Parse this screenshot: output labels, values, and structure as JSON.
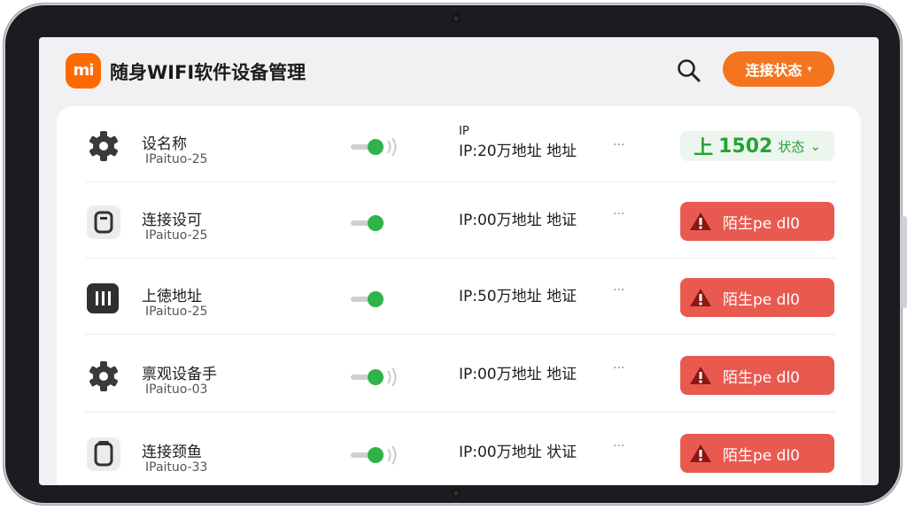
{
  "header": {
    "logo_text": "mi",
    "title": "随身WIFI软件设备管理",
    "status_button_label": "连接状态",
    "status_button_caret": "▾"
  },
  "colors": {
    "accent": "#f4741f",
    "logo": "#ff6a00",
    "online_green": "#24a234",
    "warning_red": "#e85a50"
  },
  "devices": [
    {
      "icon": "gear-icon",
      "name": "设名称",
      "sub": "IPaituo-25",
      "ip_label": "IP",
      "ip": "IP:20万地址 地址",
      "more": "···",
      "toggle_on": true,
      "status_type": "ok",
      "status_prefix": "上",
      "status_value": "1502",
      "status_suffix": "状态",
      "status_caret": "⌄"
    },
    {
      "icon": "device-square-icon",
      "name": "连接设可",
      "sub": "IPaituo-25",
      "ip": "IP:00万地址 地证",
      "more": "···",
      "toggle_on": true,
      "status_type": "warn",
      "status_text": "陌生pe dl0"
    },
    {
      "icon": "server-icon",
      "name": "上徳地址",
      "sub": "IPaituo-25",
      "ip": "IP:50万地址 地证",
      "more": "···",
      "toggle_on": true,
      "status_type": "warn",
      "status_text": "陌生pe dl0"
    },
    {
      "icon": "gear-icon",
      "name": "禀观设备手",
      "sub": "IPaituo-03",
      "ip": "IP:00万地址 地证",
      "more": "···",
      "toggle_on": true,
      "status_type": "warn",
      "status_text": "陌生pe dl0"
    },
    {
      "icon": "phone-frame-icon",
      "name": "连接颈鱼",
      "sub": "IPaituo-33",
      "ip": "IP:00万地址 状证",
      "more": "···",
      "toggle_on": true,
      "status_type": "warn",
      "status_text": "陌生pe dl0"
    }
  ]
}
